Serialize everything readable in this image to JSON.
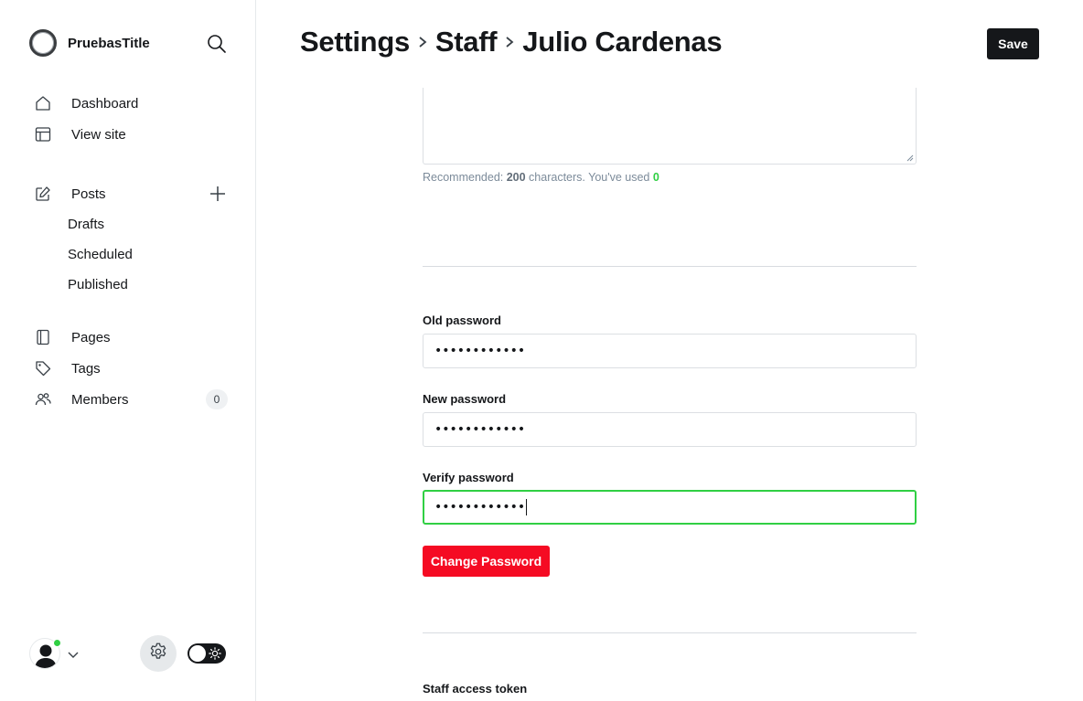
{
  "brand": {
    "name": "PruebasTitle"
  },
  "nav": {
    "dashboard": "Dashboard",
    "view_site": "View site",
    "posts": "Posts",
    "drafts": "Drafts",
    "scheduled": "Scheduled",
    "published": "Published",
    "pages": "Pages",
    "tags": "Tags",
    "members": "Members",
    "members_count": "0"
  },
  "header": {
    "crumb1": "Settings",
    "crumb2": "Staff",
    "crumb3": "Julio Cardenas",
    "save_label": "Save"
  },
  "bio": {
    "hint_prefix": "Recommended: ",
    "hint_limit": "200",
    "hint_mid": " characters. You've used ",
    "hint_used": "0"
  },
  "password": {
    "old_label": "Old password",
    "old_value": "••••••••••••",
    "new_label": "New password",
    "new_value": "••••••••••••",
    "verify_label": "Verify password",
    "verify_value": "••••••••••••",
    "change_button": "Change Password"
  },
  "token": {
    "label": "Staff access token"
  },
  "colors": {
    "accent_green": "#30cf43",
    "danger_red": "#f50b23",
    "primary_dark": "#15171a"
  }
}
